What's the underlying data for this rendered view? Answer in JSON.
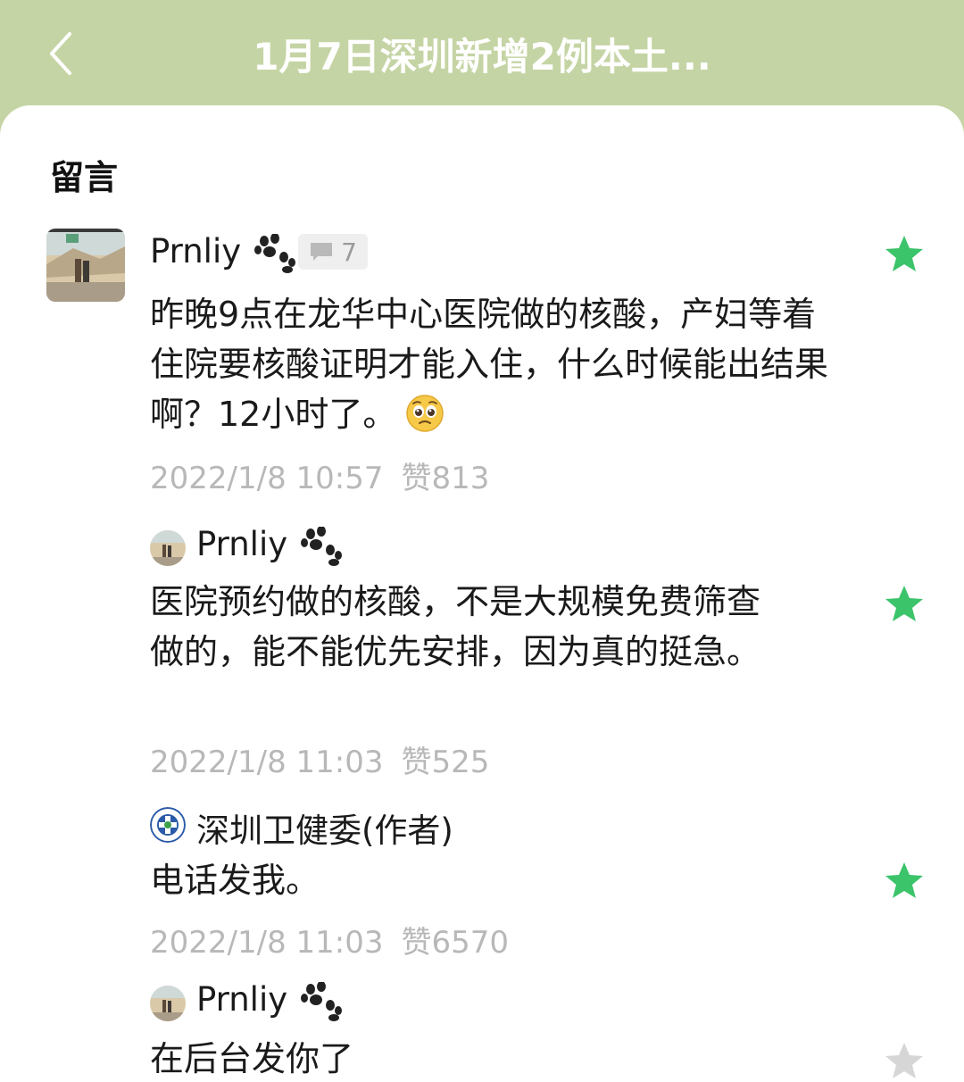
{
  "header": {
    "title": "1月7日深圳新增2例本土...",
    "back_icon": "chevron-left-icon"
  },
  "section": {
    "title": "留言"
  },
  "colors": {
    "header_bg": "#c5d4a4",
    "star_active": "#3bc46a",
    "star_inactive": "#d6d6d6",
    "meta_text": "#b8b8b8"
  },
  "comment": {
    "author": "Prnliy",
    "reply_count": "7",
    "text": "昨晚9点在龙华中心医院做的核酸，产妇等着住院要核酸证明才能入住，什么时候能出结果啊？12小时了。",
    "emoji": "pleading-face-emoji",
    "time": "2022/1/8 10:57",
    "likes": "赞813",
    "starred": true
  },
  "replies": [
    {
      "author": "Prnliy",
      "text": "医院预约做的核酸，不是大规模免费筛查做的，能不能优先安排，因为真的挺急。",
      "time": "2022/1/8 11:03",
      "likes": "赞525",
      "starred": true
    },
    {
      "author": "深圳卫健委(作者)",
      "text": "电话发我。",
      "time": "2022/1/8 11:03",
      "likes": "赞6570",
      "starred": true
    },
    {
      "author": "Prnliy",
      "text": "在后台发你了",
      "starred": false
    }
  ]
}
